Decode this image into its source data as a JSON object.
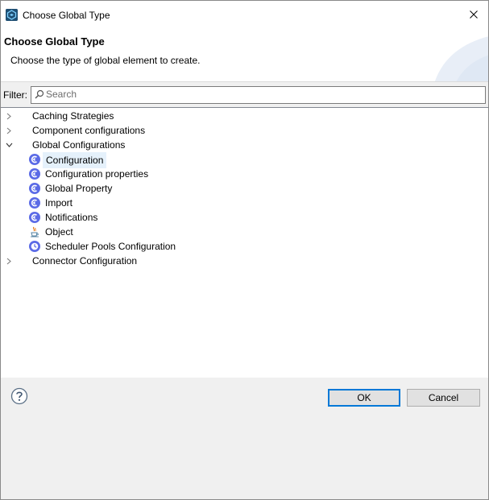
{
  "window": {
    "title": "Choose Global Type"
  },
  "header": {
    "title": "Choose Global Type",
    "description": "Choose the type of global element to create."
  },
  "filter": {
    "label": "Filter:",
    "placeholder": "Search",
    "value": ""
  },
  "tree": {
    "caching": {
      "label": "Caching Strategies",
      "expanded": false
    },
    "component": {
      "label": "Component configurations",
      "expanded": false
    },
    "global": {
      "label": "Global Configurations",
      "expanded": true,
      "children": [
        {
          "label": "Configuration",
          "icon": "config-icon",
          "selected": true
        },
        {
          "label": "Configuration properties",
          "icon": "config-icon"
        },
        {
          "label": "Global Property",
          "icon": "config-icon"
        },
        {
          "label": "Import",
          "icon": "config-icon"
        },
        {
          "label": "Notifications",
          "icon": "config-icon"
        },
        {
          "label": "Object",
          "icon": "java-icon"
        },
        {
          "label": "Scheduler Pools Configuration",
          "icon": "clock-icon"
        }
      ]
    },
    "connector": {
      "label": "Connector Configuration",
      "expanded": false
    }
  },
  "buttons": {
    "ok": "OK",
    "cancel": "Cancel"
  },
  "colors": {
    "accent": "#0078d7",
    "icon_purple": "#5b6be6",
    "selection": "#e5f1fb"
  }
}
